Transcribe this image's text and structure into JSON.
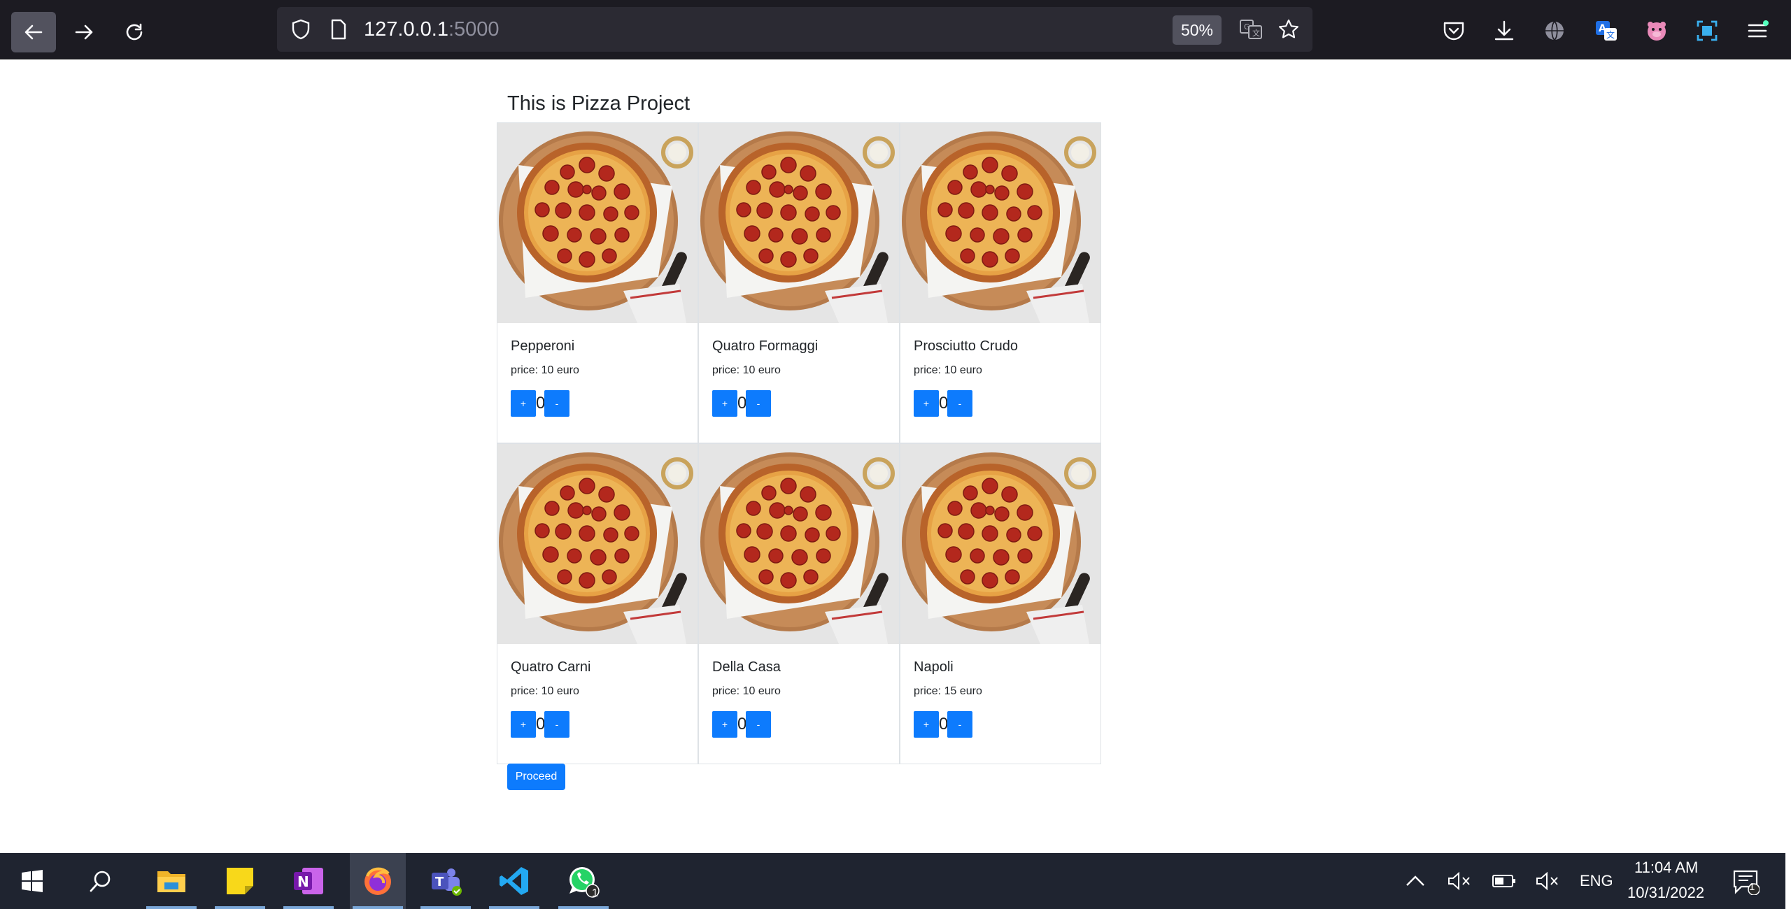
{
  "browser": {
    "url_host": "127.0.0.1",
    "url_port": ":5000",
    "zoom": "50%"
  },
  "page": {
    "title": "This is Pizza Project",
    "proceed_label": "Proceed",
    "plus_label": "+",
    "minus_label": "-",
    "price_prefix": "price:"
  },
  "products": [
    {
      "name": "Pepperoni",
      "price": "price: 10 euro",
      "qty": "0"
    },
    {
      "name": "Quatro Formaggi",
      "price": "price: 10 euro",
      "qty": "0"
    },
    {
      "name": "Prosciutto Crudo",
      "price": "price: 10 euro",
      "qty": "0"
    },
    {
      "name": "Quatro Carni",
      "price": "price: 10 euro",
      "qty": "0"
    },
    {
      "name": "Della Casa",
      "price": "price: 10 euro",
      "qty": "0"
    },
    {
      "name": "Napoli",
      "price": "price: 15 euro",
      "qty": "0"
    }
  ],
  "taskbar": {
    "time": "11:04 AM",
    "date": "10/31/2022",
    "lang": "ENG",
    "whatsapp_badge": "1",
    "notif_badge": "1"
  },
  "colors": {
    "button": "#0d7bfd",
    "chrome": "#1c1b22",
    "taskbar": "#1f2430"
  }
}
